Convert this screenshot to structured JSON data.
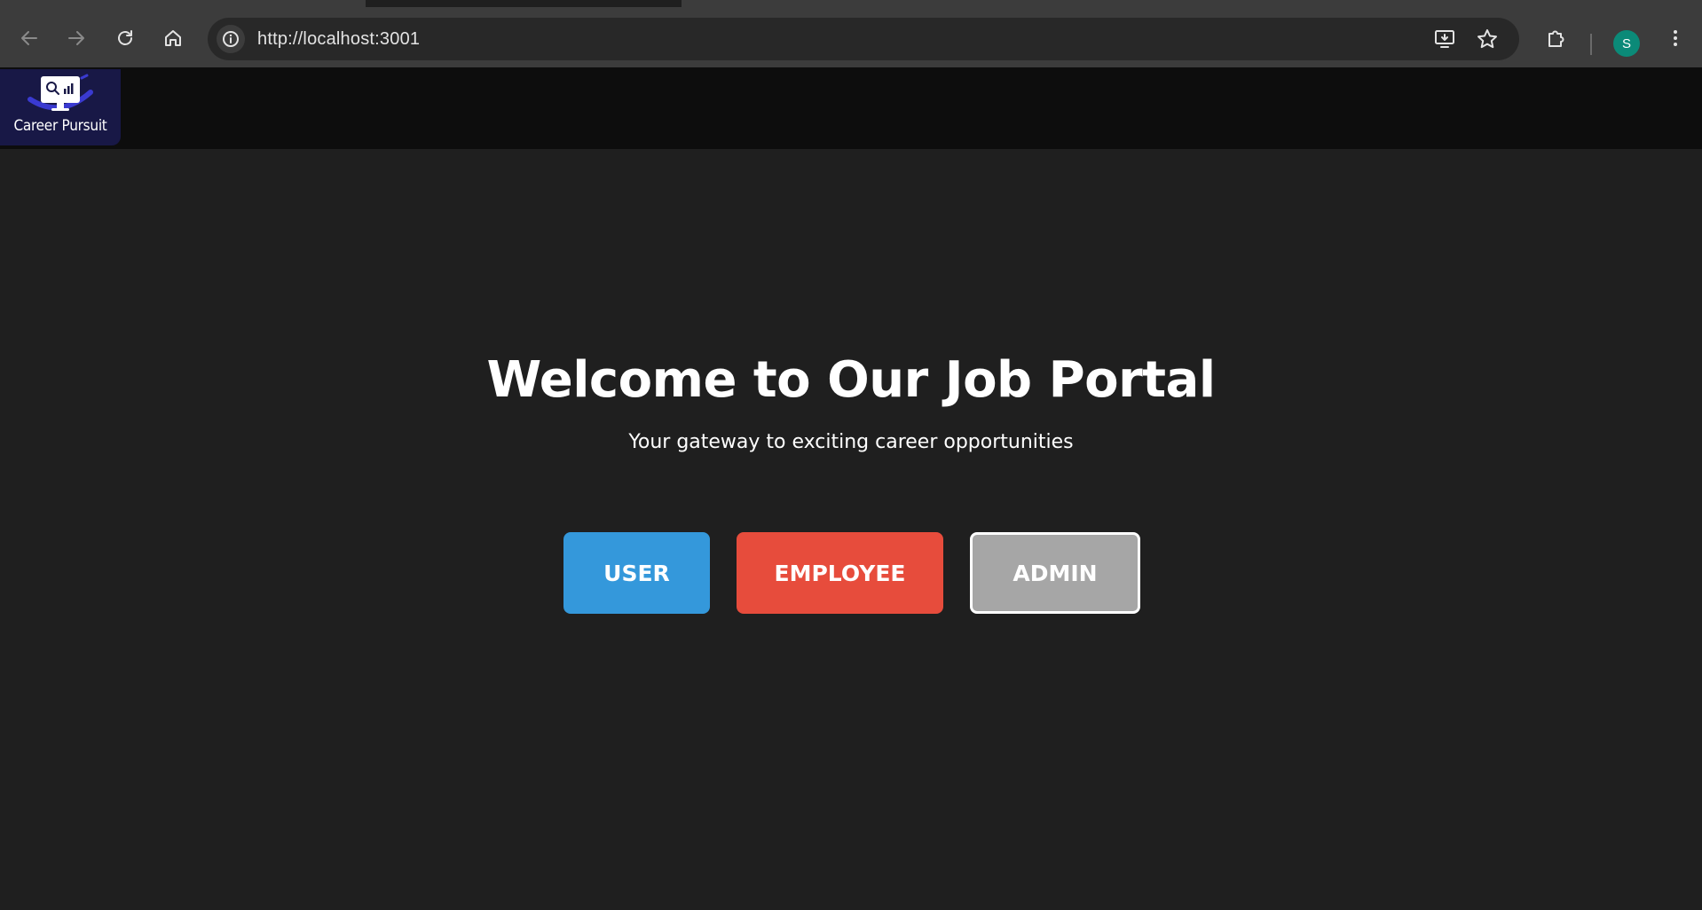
{
  "browser": {
    "url": "http://localhost:3001",
    "profile_initial": "S",
    "icons": {
      "back": "arrow-left-icon",
      "forward": "arrow-right-icon",
      "reload": "reload-icon",
      "home": "home-icon",
      "site_info": "info-icon",
      "install": "install-app-icon",
      "bookmark": "star-icon",
      "extensions": "puzzle-icon",
      "menu": "kebab-menu-icon"
    },
    "colors": {
      "toolbar": "#3c3c3c",
      "omnibox": "#282828",
      "avatar": "#0b8a78"
    }
  },
  "header": {
    "logo_text": "Career Pursuit"
  },
  "hero": {
    "title": "Welcome to Our Job Portal",
    "subtitle": "Your gateway to exciting career opportunities"
  },
  "roles": {
    "user_label": "USER",
    "employee_label": "EMPLOYEE",
    "admin_label": "ADMIN",
    "colors": {
      "user": "#3498db",
      "employee": "#e74c3c",
      "admin": "#a6a6a6"
    }
  },
  "theme": {
    "page_background": "#1f1f1f",
    "header_background": "#0d0d0d"
  }
}
